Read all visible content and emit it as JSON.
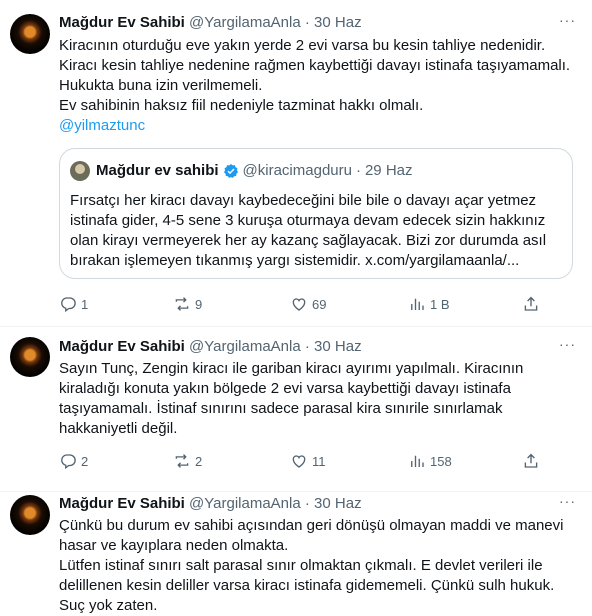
{
  "tweets": [
    {
      "name": "Mağdur Ev Sahibi",
      "handle": "@YargilamaAnla",
      "sep": "·",
      "date": "30 Haz",
      "lines": [
        "Kiracının oturduğu eve yakın yerde 2 evi varsa bu kesin tahliye nedenidir.",
        "Kiracı kesin tahliye nedenine  rağmen kaybettiği davayı istinafa taşıyamamalı. Hukukta buna izin verilmemeli.",
        "Ev sahibinin haksız fiil nedeniyle tazminat hakkı olmalı."
      ],
      "mention": "@yilmaztunc",
      "quote": {
        "name": "Mağdur ev sahibi",
        "handle": "@kiracimagduru",
        "sep": "·",
        "date": "29 Haz",
        "text": "Fırsatçı her kiracı davayı kaybedeceğini bile bile o davayı açar yetmez istinafa gider, 4-5 sene 3 kuruşa oturmaya devam edecek sizin hakkınız olan kirayı vermeyerek her ay kazanç sağlayacak. Bizi zor durumda asıl bırakan işlemeyen tıkanmış yargı sistemidir. x.com/yargilamaanla/..."
      },
      "stats": {
        "replies": "1",
        "reposts": "9",
        "likes": "69",
        "views": "1 B"
      }
    },
    {
      "name": "Mağdur Ev Sahibi",
      "handle": "@YargilamaAnla",
      "sep": "·",
      "date": "30 Haz",
      "lines": [
        "Sayın Tunç, Zengin kiracı ile gariban kiracı ayırımı yapılmalı. Kiracının kiraladığı konuta yakın bölgede 2 evi varsa kaybettiği davayı istinafa taşıyamamalı. İstinaf sınırını sadece parasal kira sınırile sınırlamak hakkaniyetli değil."
      ],
      "stats": {
        "replies": "2",
        "reposts": "2",
        "likes": "11",
        "views": "158"
      }
    },
    {
      "name": "Mağdur Ev Sahibi",
      "handle": "@YargilamaAnla",
      "sep": "·",
      "date": "30 Haz",
      "lines": [
        "Çünkü bu durum ev sahibi açısından geri dönüşü olmayan maddi ve manevi hasar ve kayıplara neden olmakta.",
        "Lütfen istinaf sınırı salt parasal sınır olmaktan çıkmalı. E devlet verileri ile delillenen kesin deliller varsa kiracı istinafa gidememeli. Çünkü sulh hukuk. Suç yok zaten."
      ]
    }
  ],
  "icons": {
    "more": "more-dots-icon",
    "reply": "reply-icon",
    "repost": "repost-icon",
    "like": "heart-icon",
    "views": "views-chart-icon",
    "share": "share-icon",
    "verified": "verified-badge-icon"
  },
  "colors": {
    "link": "#1d9bf0",
    "muted": "#536471",
    "verified": "#1d9bf0"
  }
}
